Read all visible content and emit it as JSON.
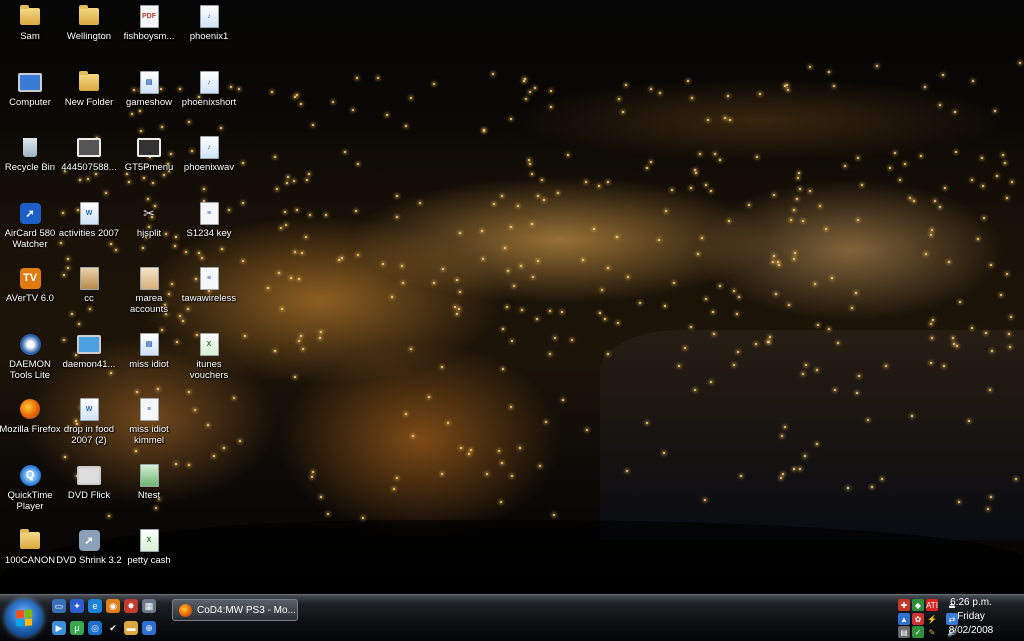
{
  "desktop": {
    "icons": [
      {
        "label": "Sam",
        "type": "folder"
      },
      {
        "label": "Wellington",
        "type": "folder"
      },
      {
        "label": "fishboysm...",
        "type": "pdf"
      },
      {
        "label": "phoenix1",
        "type": "mp3"
      },
      {
        "label": "Computer",
        "type": "computer"
      },
      {
        "label": "New Folder",
        "type": "folder"
      },
      {
        "label": "gameshow",
        "type": "doc"
      },
      {
        "label": "phoenixshort",
        "type": "mp3"
      },
      {
        "label": "Recycle Bin",
        "type": "recycle"
      },
      {
        "label": "444507588...",
        "type": "video"
      },
      {
        "label": "GT5Pmenu",
        "type": "video"
      },
      {
        "label": "phoenixwav",
        "type": "wav"
      },
      {
        "label": "AirCard 580 Watcher",
        "type": "app"
      },
      {
        "label": "activities 2007",
        "type": "word"
      },
      {
        "label": "hjsplit",
        "type": "tool"
      },
      {
        "label": "S1234 key",
        "type": "txt"
      },
      {
        "label": "AVerTV 6.0",
        "type": "app"
      },
      {
        "label": "cc",
        "type": "image"
      },
      {
        "label": "marea accounts",
        "type": "image"
      },
      {
        "label": "tawawireless",
        "type": "txt"
      },
      {
        "label": "DAEMON Tools Lite",
        "type": "app"
      },
      {
        "label": "daemon41...",
        "type": "app"
      },
      {
        "label": "miss idiot",
        "type": "doc"
      },
      {
        "label": "itunes vouchers",
        "type": "excel"
      },
      {
        "label": "Mozilla Firefox",
        "type": "firefox"
      },
      {
        "label": "drop in food 2007 (2)",
        "type": "word"
      },
      {
        "label": "miss idiot kimmel",
        "type": "doc"
      },
      {
        "label": "QuickTime Player",
        "type": "quicktime"
      },
      {
        "label": "DVD Flick",
        "type": "app"
      },
      {
        "label": "Ntest",
        "type": "image"
      },
      {
        "label": "100CANON",
        "type": "folder"
      },
      {
        "label": "DVD Shrink 3.2",
        "type": "app"
      },
      {
        "label": "petty cash",
        "type": "excel"
      }
    ]
  },
  "taskbar": {
    "task_item_label": "CoD4:MW PS3 - Mo...",
    "clock_time": "6:26 p.m.",
    "clock_day": "Friday",
    "clock_date": "8/02/2008"
  },
  "colors": {
    "taskbar": "#0d0f12",
    "start_orb": "#1c5fae",
    "folder": "#d9a93f"
  }
}
